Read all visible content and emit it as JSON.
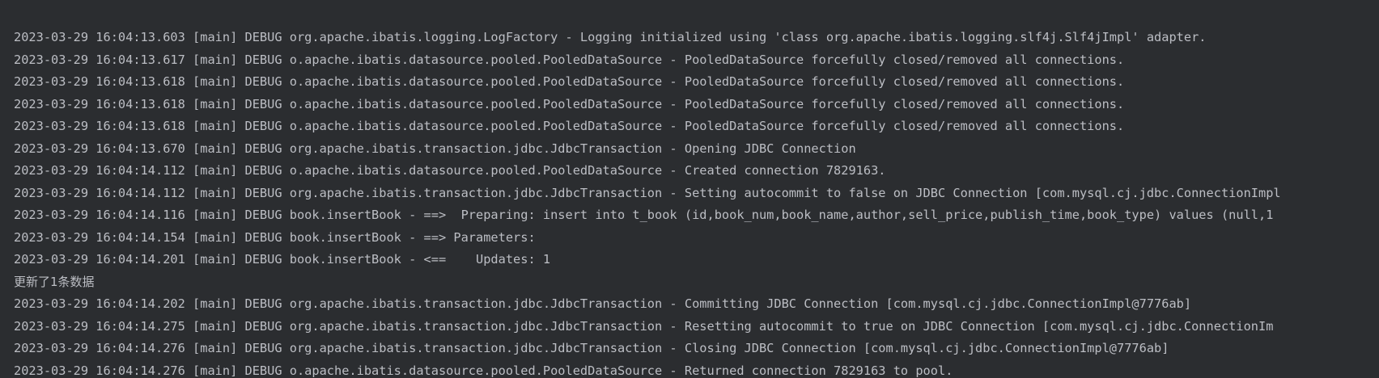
{
  "colors": {
    "background": "#2b2d30",
    "text": "#bcbec4"
  },
  "console": {
    "lines": [
      "2023-03-29 16:04:13.603 [main] DEBUG org.apache.ibatis.logging.LogFactory - Logging initialized using 'class org.apache.ibatis.logging.slf4j.Slf4jImpl' adapter.",
      "2023-03-29 16:04:13.617 [main] DEBUG o.apache.ibatis.datasource.pooled.PooledDataSource - PooledDataSource forcefully closed/removed all connections.",
      "2023-03-29 16:04:13.618 [main] DEBUG o.apache.ibatis.datasource.pooled.PooledDataSource - PooledDataSource forcefully closed/removed all connections.",
      "2023-03-29 16:04:13.618 [main] DEBUG o.apache.ibatis.datasource.pooled.PooledDataSource - PooledDataSource forcefully closed/removed all connections.",
      "2023-03-29 16:04:13.618 [main] DEBUG o.apache.ibatis.datasource.pooled.PooledDataSource - PooledDataSource forcefully closed/removed all connections.",
      "2023-03-29 16:04:13.670 [main] DEBUG org.apache.ibatis.transaction.jdbc.JdbcTransaction - Opening JDBC Connection",
      "2023-03-29 16:04:14.112 [main] DEBUG o.apache.ibatis.datasource.pooled.PooledDataSource - Created connection 7829163.",
      "2023-03-29 16:04:14.112 [main] DEBUG org.apache.ibatis.transaction.jdbc.JdbcTransaction - Setting autocommit to false on JDBC Connection [com.mysql.cj.jdbc.ConnectionImpl",
      "2023-03-29 16:04:14.116 [main] DEBUG book.insertBook - ==>  Preparing: insert into t_book (id,book_num,book_name,author,sell_price,publish_time,book_type) values (null,1",
      "2023-03-29 16:04:14.154 [main] DEBUG book.insertBook - ==> Parameters: ",
      "2023-03-29 16:04:14.201 [main] DEBUG book.insertBook - <==    Updates: 1",
      "更新了1条数据",
      "2023-03-29 16:04:14.202 [main] DEBUG org.apache.ibatis.transaction.jdbc.JdbcTransaction - Committing JDBC Connection [com.mysql.cj.jdbc.ConnectionImpl@7776ab]",
      "2023-03-29 16:04:14.275 [main] DEBUG org.apache.ibatis.transaction.jdbc.JdbcTransaction - Resetting autocommit to true on JDBC Connection [com.mysql.cj.jdbc.ConnectionIm",
      "2023-03-29 16:04:14.276 [main] DEBUG org.apache.ibatis.transaction.jdbc.JdbcTransaction - Closing JDBC Connection [com.mysql.cj.jdbc.ConnectionImpl@7776ab]",
      "2023-03-29 16:04:14.276 [main] DEBUG o.apache.ibatis.datasource.pooled.PooledDataSource - Returned connection 7829163 to pool."
    ]
  }
}
